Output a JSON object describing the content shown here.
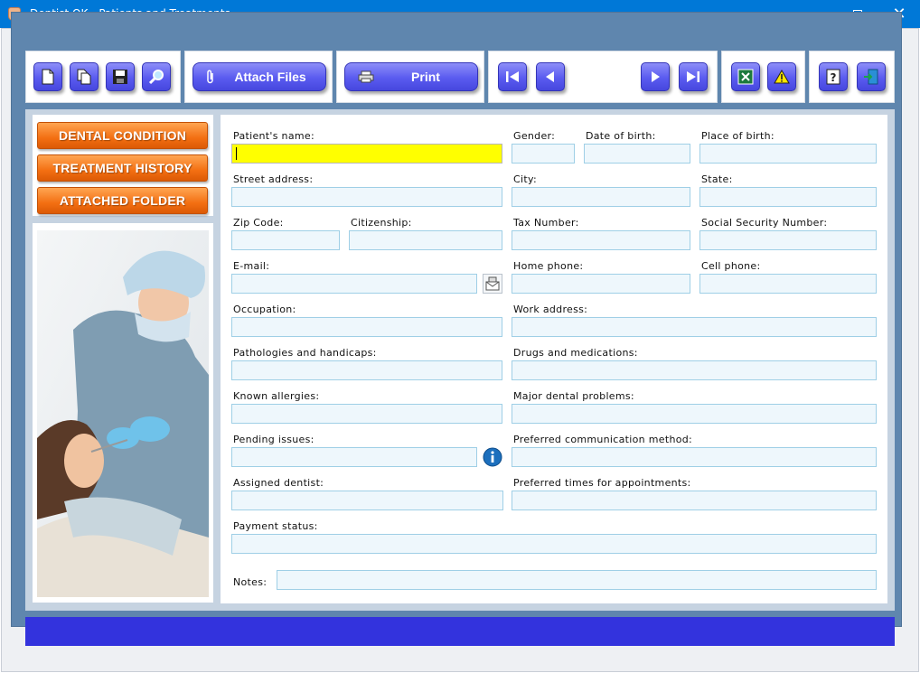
{
  "window": {
    "title": "Dentist OK - Patients and Treatments",
    "minimize": "—",
    "close": "✕"
  },
  "toolbar": {
    "attach_label": "Attach Files",
    "print_label": "Print"
  },
  "tabs": [
    {
      "label": "DENTAL CONDITION"
    },
    {
      "label": "TREATMENT HISTORY"
    },
    {
      "label": "ATTACHED FOLDER"
    }
  ],
  "form": {
    "patient_name": {
      "label": "Patient's name:",
      "value": ""
    },
    "gender": {
      "label": "Gender:",
      "value": ""
    },
    "dob": {
      "label": "Date of birth:",
      "value": ""
    },
    "pob": {
      "label": "Place of birth:",
      "value": ""
    },
    "street": {
      "label": "Street address:",
      "value": ""
    },
    "city": {
      "label": "City:",
      "value": ""
    },
    "state": {
      "label": "State:",
      "value": ""
    },
    "zip": {
      "label": "Zip Code:",
      "value": ""
    },
    "citizenship": {
      "label": "Citizenship:",
      "value": ""
    },
    "tax": {
      "label": "Tax Number:",
      "value": ""
    },
    "ssn": {
      "label": "Social Security Number:",
      "value": ""
    },
    "email": {
      "label": "E-mail:",
      "value": ""
    },
    "home_phone": {
      "label": "Home phone:",
      "value": ""
    },
    "cell_phone": {
      "label": "Cell phone:",
      "value": ""
    },
    "occupation": {
      "label": "Occupation:",
      "value": ""
    },
    "work_address": {
      "label": "Work address:",
      "value": ""
    },
    "pathologies": {
      "label": "Pathologies and handicaps:",
      "value": ""
    },
    "drugs": {
      "label": "Drugs and medications:",
      "value": ""
    },
    "allergies": {
      "label": "Known allergies:",
      "value": ""
    },
    "dental_problems": {
      "label": "Major dental problems:",
      "value": ""
    },
    "pending": {
      "label": "Pending issues:",
      "value": ""
    },
    "comm_method": {
      "label": "Preferred communication method:",
      "value": ""
    },
    "dentist": {
      "label": "Assigned dentist:",
      "value": ""
    },
    "appt_times": {
      "label": "Preferred times for appointments:",
      "value": ""
    },
    "payment": {
      "label": "Payment status:",
      "value": ""
    },
    "notes": {
      "label": "Notes:",
      "value": ""
    }
  },
  "colors": {
    "title_bar": "#0078d7",
    "frame": "#5f86ae",
    "button_blue": "#5a5bf0",
    "tab_orange": "#f36f12",
    "active_field": "#ffff00",
    "field_bg": "#eef7fc",
    "status_bar": "#3333dd"
  },
  "icons": [
    "app-tooth-icon",
    "new-document-icon",
    "copy-icon",
    "save-disk-icon",
    "search-magnifier-icon",
    "paperclip-icon",
    "printer-icon",
    "first-record-icon",
    "previous-record-icon",
    "next-record-icon",
    "last-record-icon",
    "excel-export-icon",
    "warning-icon",
    "help-icon",
    "exit-door-icon",
    "mail-compose-icon",
    "info-icon"
  ]
}
